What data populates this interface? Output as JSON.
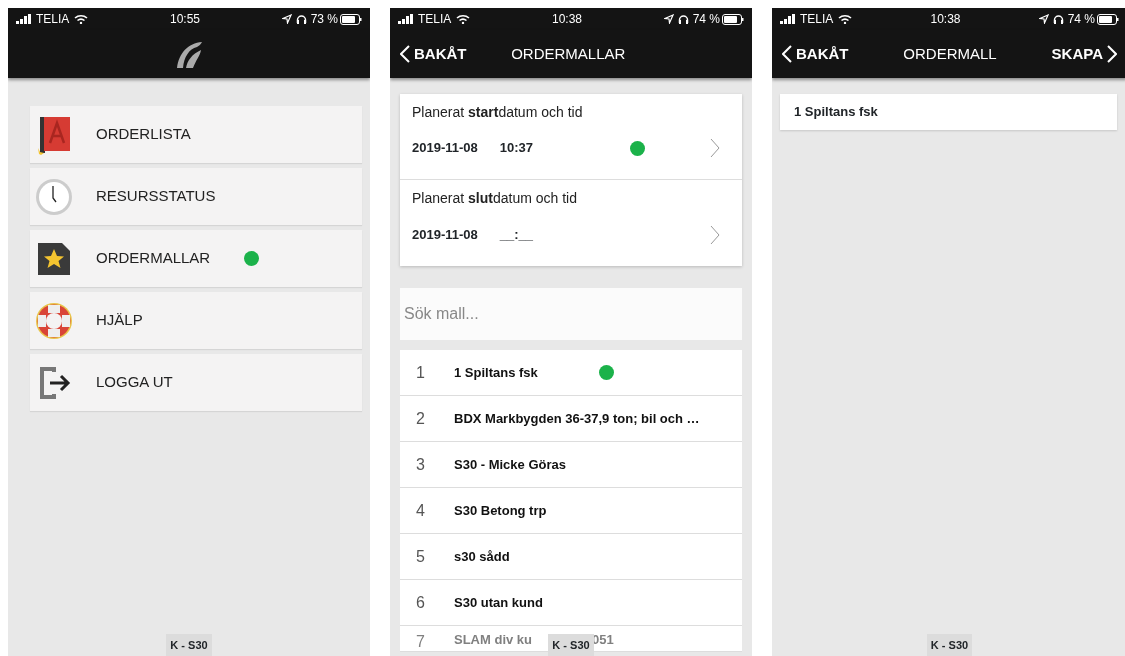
{
  "screens": [
    {
      "kind": "menu",
      "status": {
        "carrier": "TELIA",
        "time": "10:55",
        "battery": "73 %"
      },
      "menu": [
        {
          "label": "ORDERLISTA",
          "kind": "book",
          "marked": false
        },
        {
          "label": "RESURSSTATUS",
          "kind": "clock",
          "marked": false
        },
        {
          "label": "ORDERMALLAR",
          "kind": "star",
          "marked": true
        },
        {
          "label": "HJÄLP",
          "kind": "lifebuoy",
          "marked": false
        },
        {
          "label": "LOGGA UT",
          "kind": "logout",
          "marked": false
        }
      ],
      "footer": "K - S30"
    },
    {
      "kind": "templates",
      "status": {
        "carrier": "TELIA",
        "time": "10:38",
        "battery": "74 %"
      },
      "nav": {
        "back": "BAKÅT",
        "title": "ORDERMALLAR"
      },
      "dates": [
        {
          "label": "Planerat **start**datum och tid",
          "date": "2019-11-08",
          "time": "10:37",
          "marked": true
        },
        {
          "label": "Planerat **slut**datum och tid",
          "date": "2019-11-08",
          "time": "__:__",
          "marked": false
        }
      ],
      "search": {
        "placeholder": "Sök mall..."
      },
      "templates": [
        {
          "number": "1",
          "name": "1 Spiltans fsk",
          "marked": true
        },
        {
          "number": "2",
          "name": "BDX Markbygden 36-37,9 ton; bil och …",
          "marked": false
        },
        {
          "number": "3",
          "name": "S30 - Micke Göras",
          "marked": false
        },
        {
          "number": "4",
          "name": "S30 Betong trp",
          "marked": false
        },
        {
          "number": "5",
          "name": "s30 sådd",
          "marked": false
        },
        {
          "number": "6",
          "name": "S30 utan kund",
          "marked": false
        },
        {
          "number": "7",
          "name": "SLAM div ku",
          "name_end": "051",
          "marked": false
        }
      ],
      "footer": "K - S30"
    },
    {
      "kind": "template",
      "status": {
        "carrier": "TELIA",
        "time": "10:38",
        "battery": "74 %"
      },
      "nav": {
        "back": "BAKÅT",
        "title": "ORDERMALL",
        "action": "SKAPA"
      },
      "items": [
        {
          "name": "1 Spiltans fsk"
        }
      ],
      "footer": "K - S30"
    }
  ]
}
